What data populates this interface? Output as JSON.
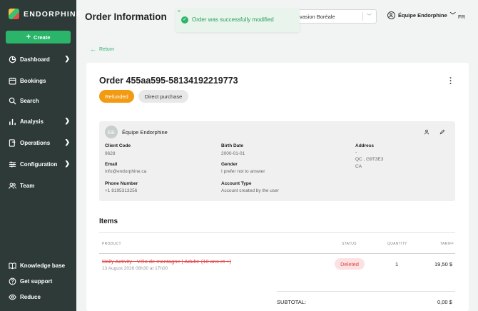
{
  "brand": {
    "name": "ENDORPHINE"
  },
  "sidebar": {
    "create_label": "Create",
    "items": [
      {
        "label": "Dashboard",
        "icon": "pie-chart-icon",
        "has_chevron": true
      },
      {
        "label": "Bookings",
        "icon": "calendar-icon",
        "has_chevron": false
      },
      {
        "label": "Search",
        "icon": "search-icon",
        "has_chevron": false
      },
      {
        "label": "Analysis",
        "icon": "bar-chart-icon",
        "has_chevron": true
      },
      {
        "label": "Operations",
        "icon": "operations-icon",
        "has_chevron": true
      },
      {
        "label": "Configuration",
        "icon": "sliders-icon",
        "has_chevron": true
      },
      {
        "label": "Team",
        "icon": "team-icon",
        "has_chevron": false
      }
    ],
    "bottom_items": [
      {
        "label": "Knowledge base",
        "icon": "book-icon"
      },
      {
        "label": "Get support",
        "icon": "help-icon"
      },
      {
        "label": "Reduce",
        "icon": "eye-icon"
      }
    ]
  },
  "header": {
    "title": "Order Information",
    "venue_select": "vasion Boréale",
    "user_name": "Équipe Endorphine",
    "language": "FR"
  },
  "toast": {
    "message": "Order was successfully modified",
    "close": "×"
  },
  "return_label": "Return",
  "order": {
    "title": "Order 455aa595-58134192219773",
    "status_badge": "Refunded",
    "type_badge": "Direct purchase"
  },
  "client": {
    "initials": "EE",
    "name": "Équipe Endorphine",
    "fields": {
      "client_code_label": "Client Code",
      "client_code": "9628",
      "email_label": "Email",
      "email": "info@endorphine.ca",
      "phone_label": "Phone Number",
      "phone": "+1 8195313256",
      "birth_date_label": "Birth Date",
      "birth_date": "2000-01-01",
      "gender_label": "Gender",
      "gender": "I prefer not to answer",
      "account_type_label": "Account Type",
      "account_type": "Account created by the user",
      "address_label": "Address",
      "address_line1": "-",
      "address_line2": "QC , G9T3E3",
      "address_line3": "CA"
    }
  },
  "items": {
    "title": "Items",
    "headers": {
      "product": "PRODUCT",
      "status": "STATUS",
      "quantity": "QUANTITY",
      "tariff": "TARIFF"
    },
    "rows": [
      {
        "product": "Daily Activity - Vélo de montagne | Adulte (18 ans et +)",
        "date": "13 August 2026 08h30 at 17h00",
        "status": "Deleted",
        "quantity": "1",
        "tariff": "19,50 $"
      }
    ],
    "subtotal_label": "SUBTOTAL:",
    "subtotal_value": "0,00 $"
  },
  "colors": {
    "sidebar_bg": "#2d3a37",
    "accent_green": "#2bb56a",
    "refunded_orange": "#f29b12",
    "deleted_red": "#e04848"
  }
}
